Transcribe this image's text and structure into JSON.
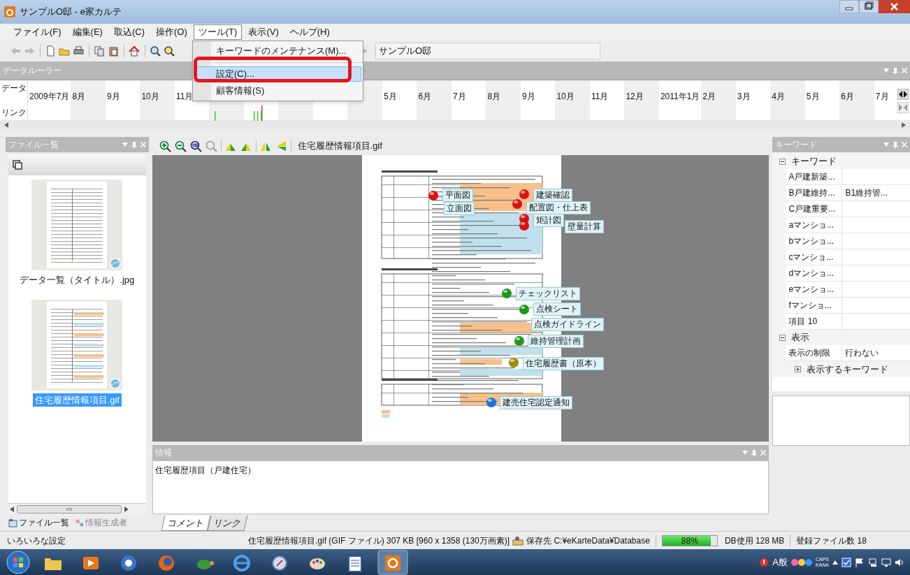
{
  "window": {
    "title": "サンプルO邸 - e家カルテ"
  },
  "menu_bar": [
    {
      "label": "ファイル(F)",
      "selected": false
    },
    {
      "label": "編集(E)",
      "selected": false
    },
    {
      "label": "取込(C)",
      "selected": false
    },
    {
      "label": "操作(O)",
      "selected": false
    },
    {
      "label": "ツール(T)",
      "selected": true
    },
    {
      "label": "表示(V)",
      "selected": false
    },
    {
      "label": "ヘルプ(H)",
      "selected": false
    }
  ],
  "open_menu": {
    "items": [
      {
        "kind": "item",
        "label": "キーワードのメンテナンス(M)...",
        "selected": false
      },
      {
        "kind": "separator"
      },
      {
        "kind": "item",
        "label": "設定(C)...",
        "selected": true
      },
      {
        "kind": "item",
        "label": "顧客情報(S)",
        "selected": false
      }
    ]
  },
  "toolbar": {
    "location": "サンプルO邸"
  },
  "data_ruler": {
    "title": "データルーラー",
    "row_labels": [
      "データ",
      "リンク"
    ],
    "months_left": [
      "2009年7月",
      "8月",
      "9月",
      "10月",
      "11月"
    ],
    "months_right": [
      "5月",
      "6月",
      "7月",
      "8月",
      "9月",
      "10月",
      "11月",
      "12月",
      "2011年1月",
      "2月",
      "3月",
      "4月",
      "5月",
      "6月",
      "7月"
    ]
  },
  "file_panel": {
    "title": "ファイル一覧",
    "files": [
      {
        "name": "データ一覧（タイトル）.jpg",
        "selected": false
      },
      {
        "name": "住宅履歴情報項目.gif",
        "selected": true
      }
    ]
  },
  "viewer": {
    "file_name": "住宅履歴情報項目.gif",
    "callouts": [
      {
        "label": "平面図",
        "color": "#e01010"
      },
      {
        "label": "立面図"
      },
      {
        "label": "建築確認",
        "color": "#e01010"
      },
      {
        "label": "配置図・仕上表",
        "color": "#e01010"
      },
      {
        "label": "矩計図",
        "color": "#e01010"
      },
      {
        "label": "壁量計算",
        "color": "#e01010"
      },
      {
        "label": "チェックリスト",
        "color": "#1a9a1a"
      },
      {
        "label": "点検シート",
        "color": "#1a9a1a"
      },
      {
        "label": "点検ガイドライン"
      },
      {
        "label": "維持管理計画",
        "color": "#1a9a1a"
      },
      {
        "label": "住宅履歴書（原本）",
        "color": "#a08a10"
      },
      {
        "label": "建売住宅認定通知",
        "color": "#1a70e0"
      }
    ]
  },
  "keyword_panel": {
    "title": "キーワード",
    "groups": [
      {
        "label": "キーワード",
        "expanded": true,
        "rows": [
          {
            "name": "A戸建新築..."
          },
          {
            "name": "B戸建維持...",
            "value": "B1維持管..."
          },
          {
            "name": "C戸建重要..."
          },
          {
            "name": "aマンショ..."
          },
          {
            "name": "bマンショ..."
          },
          {
            "name": "cマンショ..."
          },
          {
            "name": "dマンショ..."
          },
          {
            "name": "eマンショ..."
          },
          {
            "name": "fマンショ..."
          },
          {
            "name": "項目 10"
          }
        ]
      },
      {
        "label": "表示",
        "expanded": true,
        "rows": [
          {
            "name": "表示の制限",
            "value": "行わない"
          }
        ],
        "children": [
          {
            "label": "表示するキーワード",
            "expanded": false
          }
        ]
      }
    ]
  },
  "info_panel": {
    "title": "情報",
    "text": "住宅履歴項目（戸建住宅）"
  },
  "left_tabs": [
    {
      "label": "ファイル一覧",
      "selected": true
    },
    {
      "label": "情報生成者",
      "selected": false
    }
  ],
  "bottom_tabs": [
    {
      "label": "コメント",
      "selected": true
    },
    {
      "label": "リンク",
      "selected": false
    }
  ],
  "status_bar": {
    "message": "いろいろな設定",
    "file_info": "住宅履歴情報項目.gif (GIF ファイル) 307 KB [960 x 1358 (130万画素)]",
    "save_location": "保存先 C:¥eKarteData¥Database",
    "progress": {
      "level": 0.88,
      "text": "88%"
    },
    "db_usage": "DB使用 128 MB",
    "file_count": "登録ファイル数 18"
  },
  "taskbar": {
    "ime": "A般",
    "caps": "CAPS",
    "kana": "KANA"
  }
}
